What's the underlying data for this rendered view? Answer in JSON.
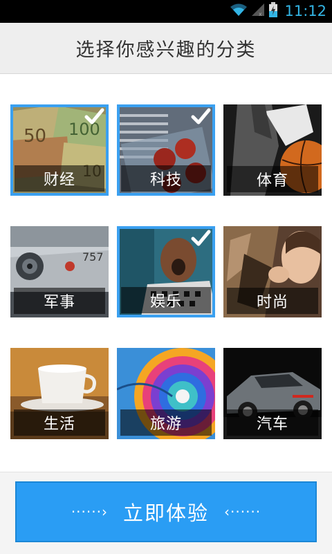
{
  "status_bar": {
    "time": "11:12",
    "icons": [
      "wifi-icon",
      "signal-icon",
      "battery-charging-icon"
    ]
  },
  "header": {
    "title": "选择你感兴趣的分类"
  },
  "categories": [
    {
      "label": "财经",
      "selected": true,
      "theme": "money"
    },
    {
      "label": "科技",
      "selected": true,
      "theme": "lab"
    },
    {
      "label": "体育",
      "selected": false,
      "theme": "basketball"
    },
    {
      "label": "军事",
      "selected": false,
      "theme": "jet"
    },
    {
      "label": "娱乐",
      "selected": true,
      "theme": "singer"
    },
    {
      "label": "时尚",
      "selected": false,
      "theme": "fur"
    },
    {
      "label": "生活",
      "selected": false,
      "theme": "coffee"
    },
    {
      "label": "旅游",
      "selected": false,
      "theme": "balloon"
    },
    {
      "label": "汽车",
      "selected": false,
      "theme": "car"
    }
  ],
  "footer": {
    "button_label": "立即体验",
    "left_arrow": "······›",
    "right_arrow": "‹······"
  },
  "colors": {
    "accent": "#2a9df4",
    "selected_border": "#3aa0f0",
    "status_text": "#33b5e5"
  }
}
